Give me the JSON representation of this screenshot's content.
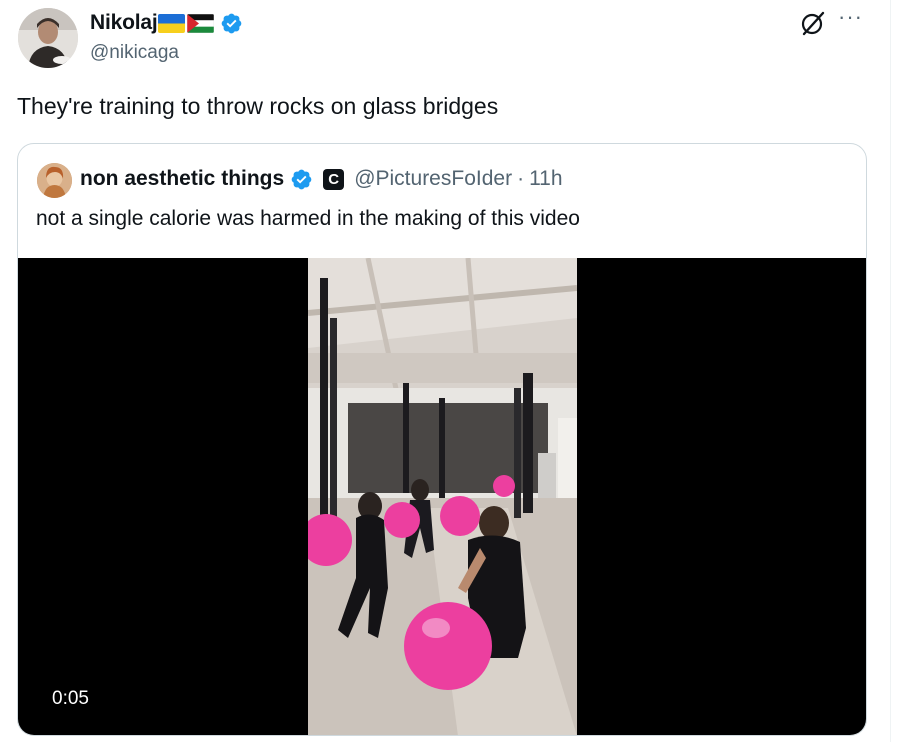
{
  "tweet": {
    "author": {
      "name": "Nikolaj",
      "flags": [
        "ukraine-flag",
        "palestine-flag"
      ],
      "handle": "@nikicaga",
      "verified": true
    },
    "text": "They're training to throw rocks on glass bridges"
  },
  "quote": {
    "author": {
      "name": "non aesthetic things",
      "badge": "C",
      "handle": "@PicturesFoIder",
      "separator": "·",
      "time": "11h",
      "verified": true
    },
    "text": "not a single calorie was harmed in the making of this video",
    "video": {
      "timestamp": "0:05"
    }
  },
  "colors": {
    "verified_blue": "#1d9bf0",
    "secondary_text": "#536471",
    "border": "#cfd9de",
    "ball_pink": "#ec3f9f"
  },
  "icons": [
    "grok-icon",
    "more-icon",
    "verified-icon"
  ]
}
